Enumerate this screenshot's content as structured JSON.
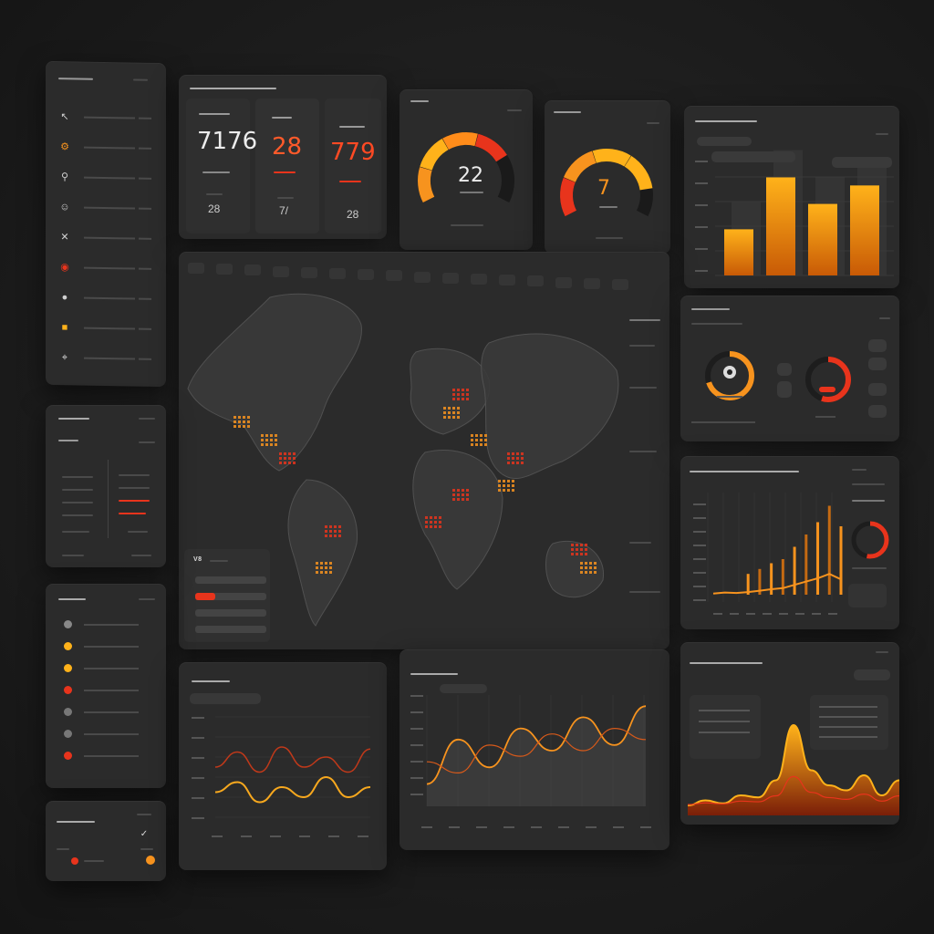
{
  "colors": {
    "accent_orange": "#f7931e",
    "accent_amber": "#ffb21a",
    "accent_red": "#e8341c",
    "panel": "#2b2b2b",
    "background": "#1c1c1c"
  },
  "sidebar": {
    "icons": [
      "cursor-icon",
      "gear-icon",
      "pin-icon",
      "user-icon",
      "tools-icon",
      "target-icon",
      "circle-icon",
      "chat-icon",
      "location-icon"
    ]
  },
  "kpi": {
    "value_1": "7176",
    "value_2": "28",
    "value_3": "779",
    "small_1": "28",
    "small_2": "7/",
    "small_3": "28"
  },
  "gauge_1": {
    "value": "22",
    "level": 0.75
  },
  "gauge_2": {
    "value": "7",
    "level": 0.85
  },
  "map_legend": {
    "label": "V8"
  },
  "bar_chart": {
    "values": [
      0.4,
      0.85,
      0.62,
      0.78
    ]
  },
  "line_chart_1": {
    "series_a": [
      0.5,
      0.65,
      0.45,
      0.7,
      0.5,
      0.6,
      0.45,
      0.68
    ],
    "series_b": [
      0.25,
      0.35,
      0.15,
      0.3,
      0.2,
      0.4,
      0.2,
      0.3
    ]
  },
  "line_chart_2": {
    "series_a": [
      0.2,
      0.6,
      0.35,
      0.7,
      0.5,
      0.8,
      0.55,
      0.9
    ],
    "series_b": [
      0.4,
      0.3,
      0.55,
      0.45,
      0.65,
      0.5,
      0.7,
      0.6
    ]
  },
  "spike_chart": {
    "values": [
      0.05,
      0.1,
      0.08,
      0.12,
      0.18,
      0.25,
      0.3,
      0.45,
      0.6,
      0.75,
      0.95,
      0.7
    ]
  },
  "area_chart": {
    "values": [
      0.1,
      0.15,
      0.12,
      0.2,
      0.18,
      0.35,
      0.9,
      0.45,
      0.3,
      0.25,
      0.4,
      0.2,
      0.35
    ]
  }
}
